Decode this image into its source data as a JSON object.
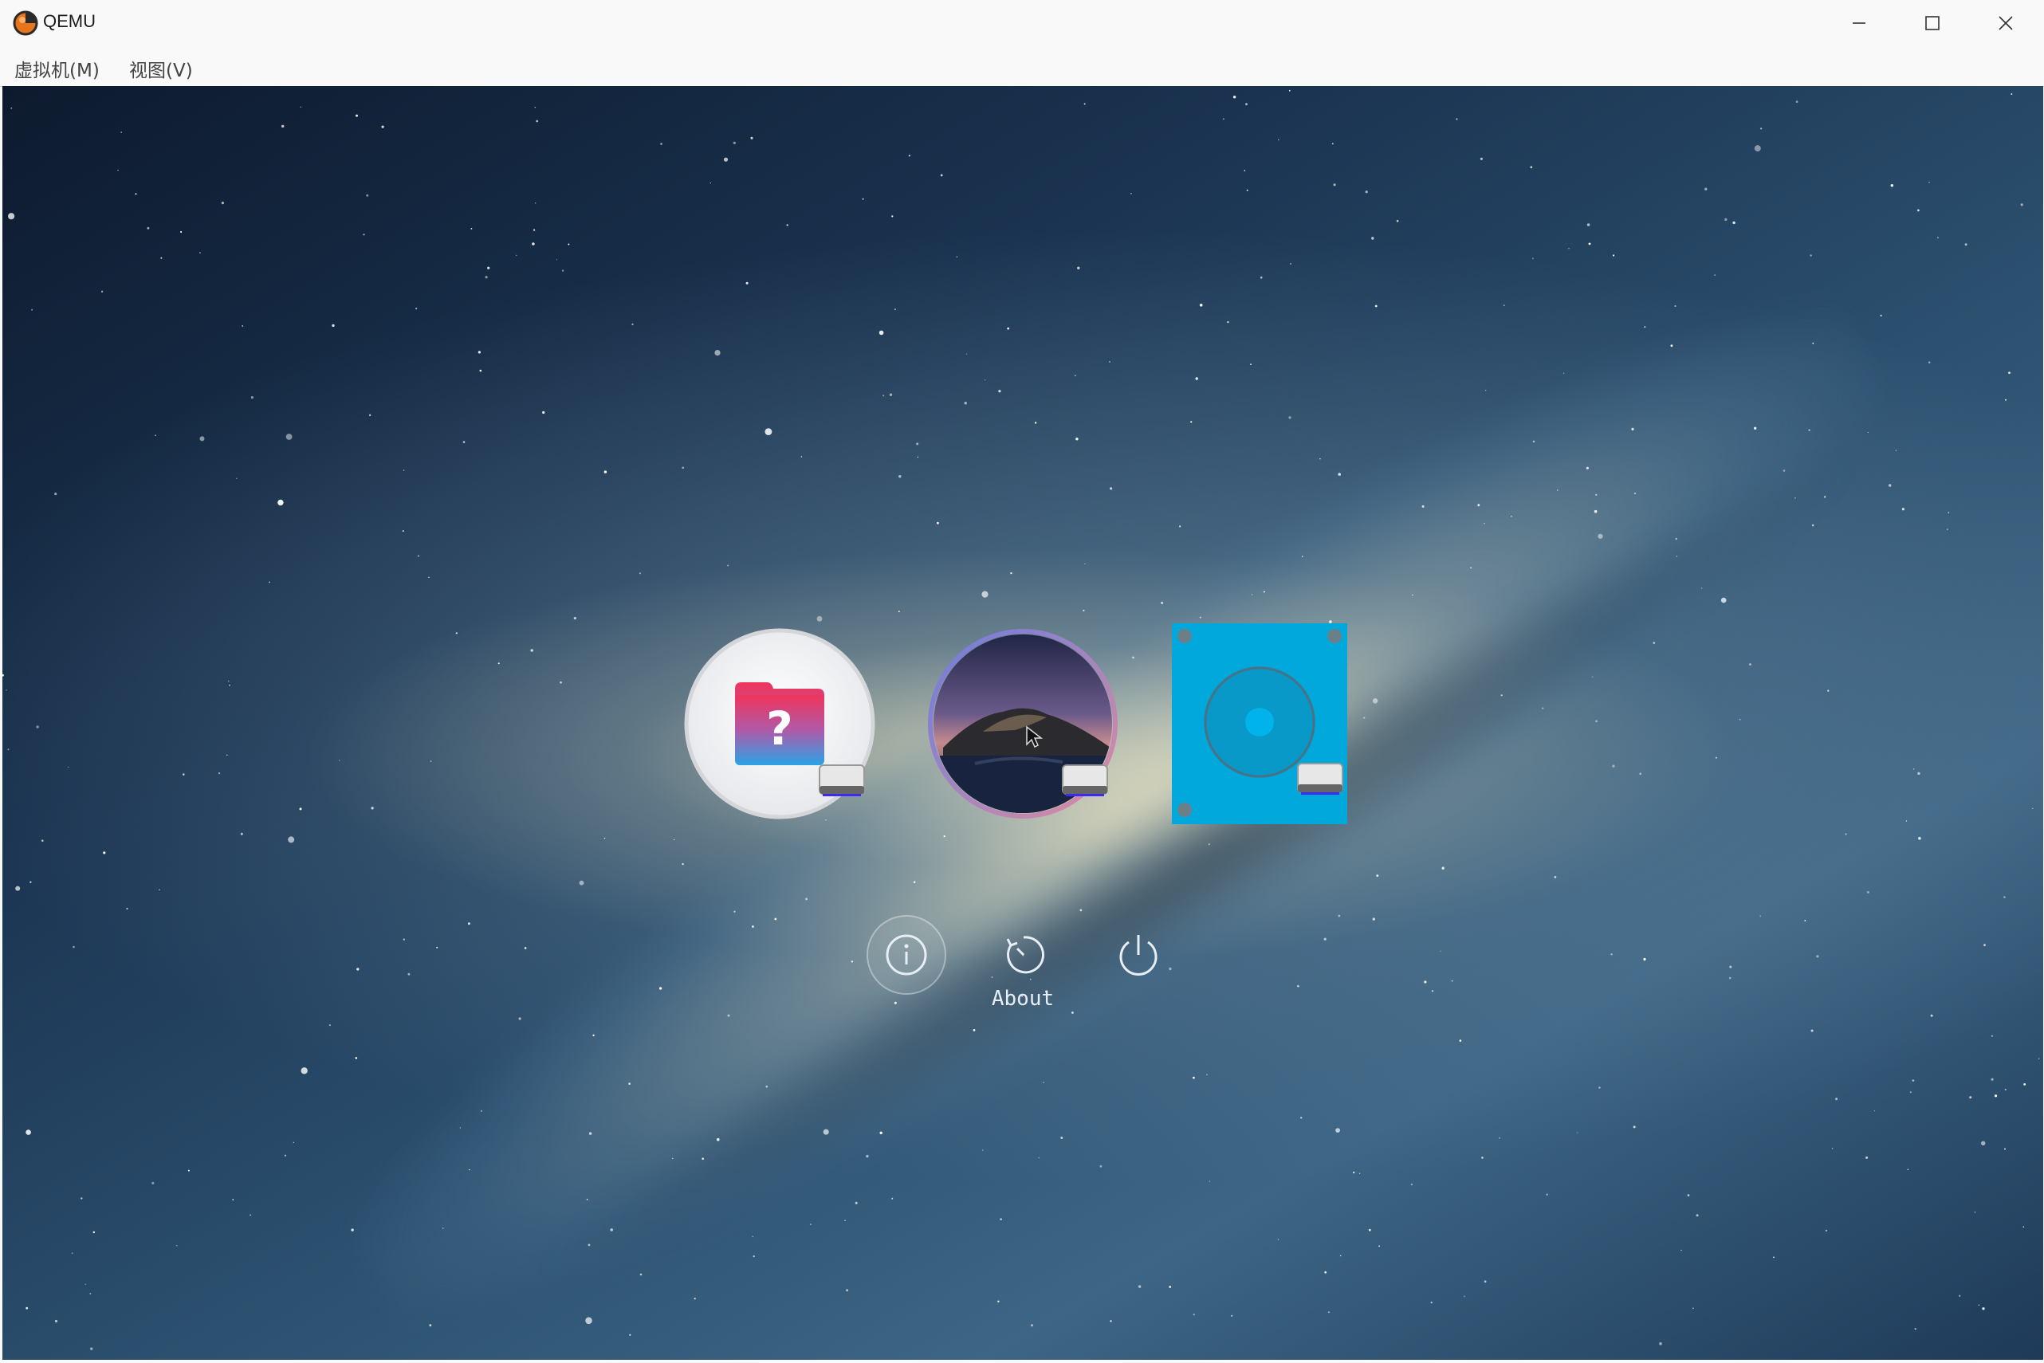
{
  "window": {
    "title": "QEMU",
    "controls": {
      "minimize": "minimize",
      "maximize": "maximize",
      "close": "close"
    }
  },
  "menubar": {
    "items": [
      {
        "label": "虚拟机(M)"
      },
      {
        "label": "视图(V)"
      }
    ]
  },
  "bootpicker": {
    "entries": [
      {
        "name": "recovery",
        "icon": "recovery-folder-icon",
        "accent": "#e8355a"
      },
      {
        "name": "macos-catalina",
        "icon": "catalina-icon",
        "selected": true
      },
      {
        "name": "hard-disk",
        "icon": "hard-disk-icon",
        "accent": "#00a8dc"
      }
    ],
    "tools": [
      {
        "name": "about",
        "icon": "info-icon",
        "focused": true
      },
      {
        "name": "reset",
        "icon": "restart-icon"
      },
      {
        "name": "shutdown",
        "icon": "power-icon"
      }
    ],
    "selected_label": "About"
  },
  "colors": {
    "titlebar_bg": "#f9f9f9",
    "disk_blue": "#00a8dc",
    "folder_red": "#e8355a",
    "folder_blue": "#2f9be0"
  }
}
